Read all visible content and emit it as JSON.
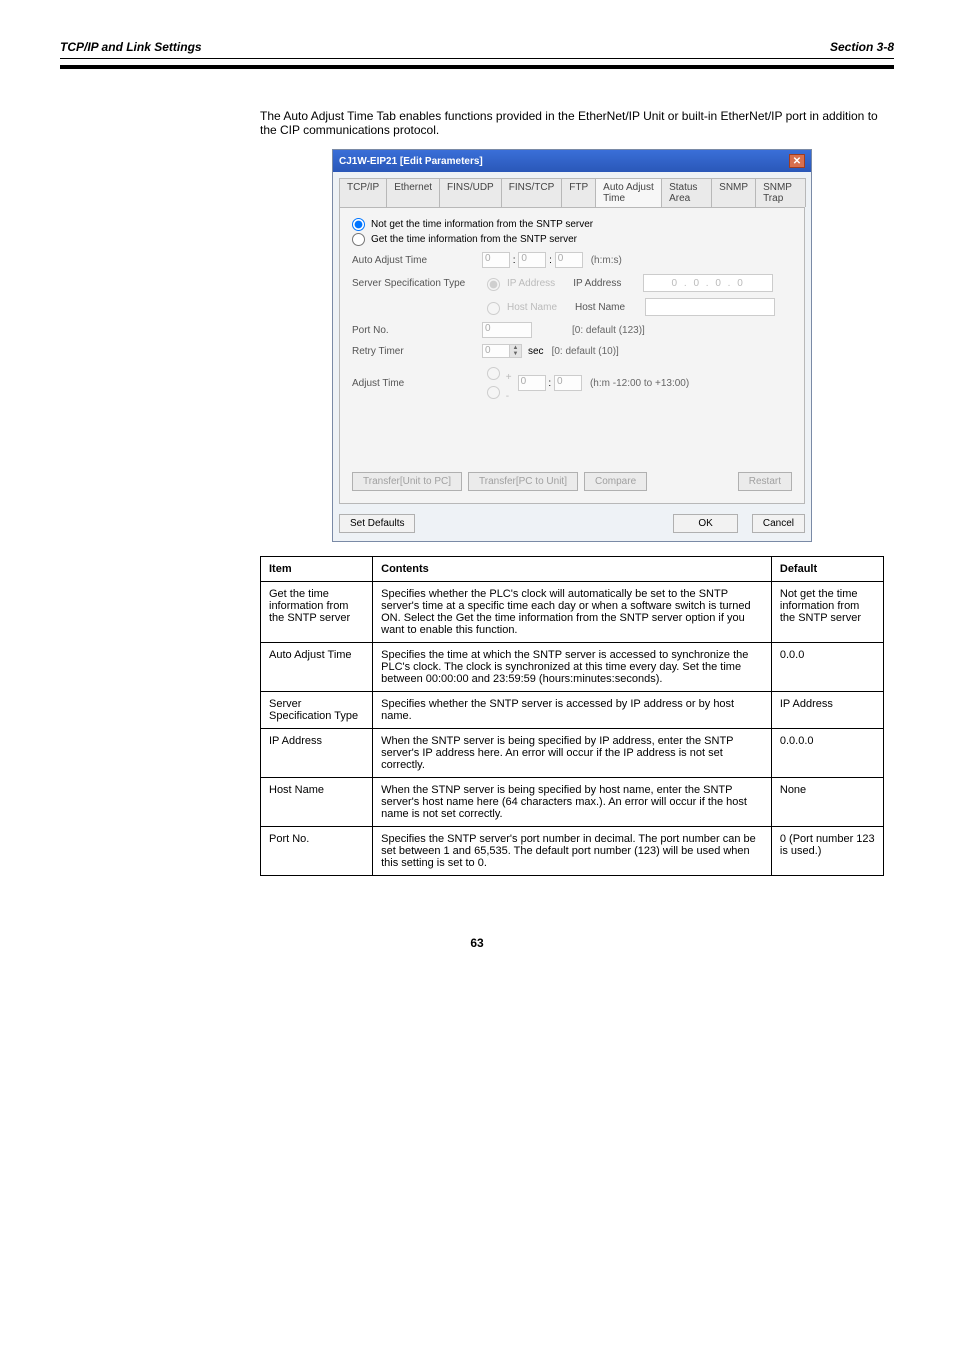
{
  "header": {
    "left": "TCP/IP and Link Settings",
    "right": "Section 3-8"
  },
  "intro": "The Auto Adjust Time Tab enables functions provided in the EtherNet/IP Unit or built-in EtherNet/IP port in addition to the CIP communications protocol.",
  "dialog": {
    "title": "CJ1W-EIP21 [Edit Parameters]",
    "tabs": [
      "TCP/IP",
      "Ethernet",
      "FINS/UDP",
      "FINS/TCP",
      "FTP",
      "Auto Adjust Time",
      "Status Area",
      "SNMP",
      "SNMP Trap"
    ],
    "activeTab": "Auto Adjust Time",
    "radio1": "Not get the time information from the SNTP server",
    "radio2": "Get the time information from the SNTP server",
    "autoAdjust": {
      "label": "Auto Adjust Time",
      "h": "0",
      "m": "0",
      "s": "0",
      "unit": "(h:m:s)"
    },
    "serverSpec": {
      "label": "Server Specification Type",
      "optIp": "IP Address",
      "optHost": "Host Name",
      "ipLabel": "IP Address",
      "ipVal": "0 . 0 . 0 . 0",
      "hostLabel": "Host Name"
    },
    "portNo": {
      "label": "Port No.",
      "val": "0",
      "hint": "[0: default (123)]"
    },
    "retry": {
      "label": "Retry Timer",
      "val": "0",
      "unit": "sec",
      "hint": "[0: default (10)]"
    },
    "adjust": {
      "label": "Adjust Time",
      "h": "0",
      "m": "0",
      "hint": "(h:m  -12:00 to +13:00)"
    },
    "btns": {
      "u2p": "Transfer[Unit to PC]",
      "p2u": "Transfer[PC to Unit]",
      "cmp": "Compare",
      "restart": "Restart",
      "defaults": "Set Defaults",
      "ok": "OK",
      "cancel": "Cancel"
    }
  },
  "table": {
    "headers": [
      "Item",
      "Contents",
      "Default"
    ],
    "rows": [
      {
        "item": "Get the time information from the SNTP server",
        "content": "Specifies whether the PLC's clock will automatically be set to the SNTP server's time at a specific time each day or when a software switch is turned ON. Select the Get the time information from the SNTP server option if you want to enable this function.",
        "def": "Not get the time information from the SNTP server"
      },
      {
        "item": "Auto Adjust Time",
        "content": "Specifies the time at which the SNTP server is accessed to synchronize the PLC's clock. The clock is synchronized at this time every day. Set the time between 00:00:00 and 23:59:59 (hours:minutes:seconds).",
        "def": "0.0.0"
      },
      {
        "item": "Server Specification Type",
        "content": "Specifies whether the SNTP server is accessed by IP address or by host name.",
        "def": "IP Address"
      },
      {
        "item": "IP Address",
        "content": "When the SNTP server is being specified by IP address, enter the SNTP server's IP address here. An error will occur if the IP address is not set correctly.",
        "def": "0.0.0.0"
      },
      {
        "item": "Host Name",
        "content": "When the STNP server is being specified by host name, enter the SNTP server's host name here (64 characters max.). An error will occur if the host name is not set correctly.",
        "def": "None"
      },
      {
        "item": "Port No.",
        "content": "Specifies the SNTP server's port number in decimal. The port number can be set between 1 and 65,535. The default port number (123) will be used when this setting is set to 0.",
        "def": "0 (Port number 123 is used.)"
      }
    ]
  },
  "pagenum": "63"
}
